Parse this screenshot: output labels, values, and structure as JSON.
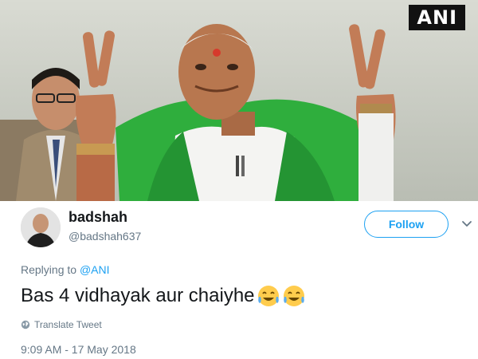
{
  "photo": {
    "watermark": "ANI",
    "icon": "press-photo"
  },
  "tweet": {
    "author": {
      "display_name": "badshah",
      "handle": "@badshah637",
      "avatar_icon": "avatar-photo"
    },
    "follow_label": "Follow",
    "menu_icon": "chevron-down-icon",
    "replying_prefix": "Replying to",
    "replying_to": "@ANI",
    "text": "Bas 4 vidhayak aur chaiyhe",
    "emojis": [
      "face-with-tears-of-joy",
      "face-with-tears-of-joy"
    ],
    "translate_label": "Translate Tweet",
    "translate_icon": "globe-icon",
    "timestamp": "9:09 AM - 17 May 2018"
  },
  "colors": {
    "accent": "#1da1f2",
    "text_primary": "#14171a",
    "text_secondary": "#657786"
  }
}
